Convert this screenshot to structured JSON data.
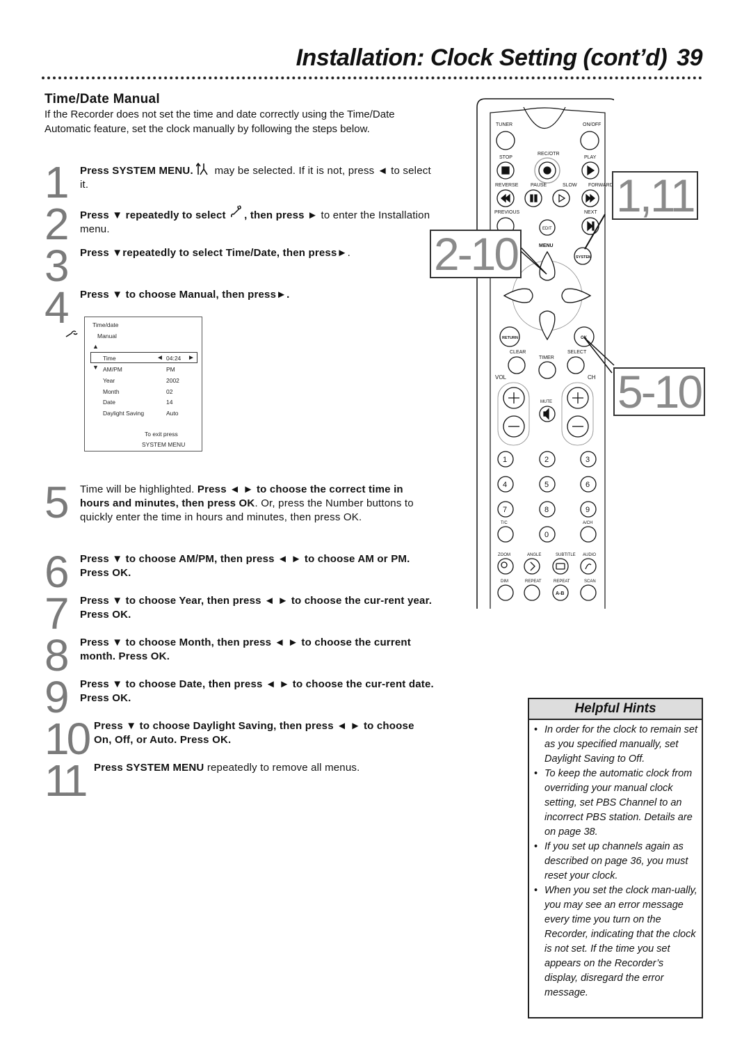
{
  "header": {
    "title": "Installation: Clock Setting (cont’d)",
    "page_number": "39"
  },
  "section": {
    "title": "Time/Date Manual",
    "intro": "If the Recorder does not set the time and date correctly using the Time/Date Automatic feature, set the clock manually by following the steps below."
  },
  "steps": [
    {
      "num": "1",
      "bold": "Press SYSTEM MENU.",
      "icon": "setup-icon",
      "rest": " may be selected. If it is not, press ◄ to select it."
    },
    {
      "num": "2",
      "bold": "Press ▼ repeatedly to select",
      "icon": "installation-wrench-icon",
      "bold2": ", then press ►",
      "rest": " to enter the Installation menu."
    },
    {
      "num": "3",
      "bold": "Press ▼repeatedly to select Time/Date, then press►",
      "rest": "."
    },
    {
      "num": "4",
      "bold": "Press ▼ to choose Manual, then press►."
    },
    {
      "num": "5",
      "pre": "Time will be highlighted. ",
      "bold": "Press ◄ ► to choose the correct time in hours and minutes, then press OK",
      "rest": ". Or, press the Number buttons to quickly enter the time in hours and minutes, then press OK."
    },
    {
      "num": "6",
      "bold": "Press ▼ to choose AM/PM, then press ◄ ► to choose AM or PM. Press OK."
    },
    {
      "num": "7",
      "bold": "Press ▼ to choose Year, then press ◄ ► to choose the cur-rent year. Press OK."
    },
    {
      "num": "8",
      "bold": "Press ▼ to choose Month, then press ◄ ► to choose the current month. Press OK."
    },
    {
      "num": "9",
      "bold": "Press ▼ to choose Date, then press ◄ ► to choose the cur-rent date. Press OK."
    },
    {
      "num": "10",
      "bold": "Press ▼ to choose Daylight Saving, then press ◄ ► to choose On, Off, or Auto.  Press OK."
    },
    {
      "num": "11",
      "bold": "Press SYSTEM MENU",
      "rest": " repeatedly to remove all menus."
    }
  ],
  "osd": {
    "title": "Time/date",
    "subtitle": "Manual",
    "up_arrow": "▲",
    "down_arrow": "▼",
    "rows": [
      {
        "label": "Time",
        "value": "04:24",
        "selected": true
      },
      {
        "label": "AM/PM",
        "value": "PM"
      },
      {
        "label": "Year",
        "value": "2002"
      },
      {
        "label": "Month",
        "value": "02"
      },
      {
        "label": "Date",
        "value": "14"
      },
      {
        "label": "Daylight Saving",
        "value": "Auto"
      }
    ],
    "left_arrow": "◄",
    "right_arrow": "►",
    "exit_line1": "To exit press",
    "exit_line2": "SYSTEM MENU"
  },
  "remote": {
    "labels": {
      "tuner": "TUNER",
      "onoff": "ON/OFF",
      "stop": "STOP",
      "recotr": "REC/OTR",
      "play": "PLAY",
      "reverse": "REVERSE",
      "pause": "PAUSE",
      "slow": "SLOW",
      "forward": "FORWARD",
      "previous": "PREVIOUS",
      "next": "NEXT",
      "edit": "EDIT",
      "menu": "MENU",
      "system": "SYSTEM",
      "return": "RETURN",
      "ok": "OK",
      "clear": "CLEAR",
      "timer": "TIMER",
      "select": "SELECT",
      "vol": "VOL",
      "ch": "CH",
      "mute": "MUTE",
      "tc": "T/C",
      "ach": "A/CH",
      "zoom": "ZOOM",
      "angle": "ANGLE",
      "subtitle": "SUBTITLE",
      "audio": "AUDIO",
      "dim": "DIM",
      "repeat": "REPEAT",
      "repeat_ab": "REPEAT",
      "ab": "A-B",
      "scan": "SCAN"
    },
    "digits": [
      "1",
      "2",
      "3",
      "4",
      "5",
      "6",
      "7",
      "8",
      "9",
      "0"
    ]
  },
  "callouts": {
    "system": "1,11",
    "arrows": "2-10",
    "ok": "5-10"
  },
  "hints": {
    "title": "Helpful Hints",
    "items": [
      "In order for the clock to remain set as you specified manually, set Daylight Saving to Off.",
      "To keep the automatic clock from overriding your manual clock setting, set PBS Channel to an incorrect PBS station. Details are on page 38.",
      "If you set up channels again as described on page 36, you must reset your clock.",
      "When you set the clock man-ually, you may see an error message every time you turn on the Recorder, indicating that the clock is not set. If the time you set appears on the Recorder’s display, disregard the error message."
    ]
  }
}
